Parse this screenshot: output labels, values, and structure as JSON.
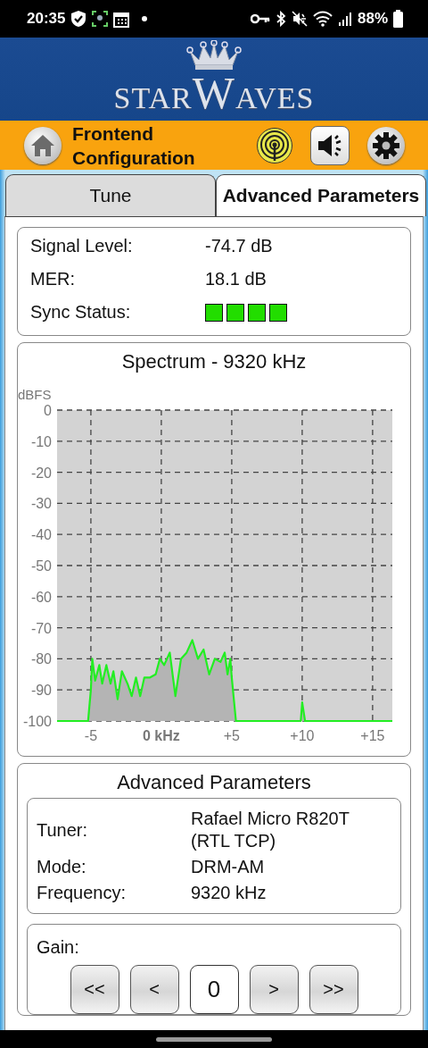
{
  "status_bar": {
    "time": "20:35",
    "battery": "88%"
  },
  "header": {
    "logo": [
      "STAR",
      "W",
      "AVES"
    ]
  },
  "toolbar": {
    "title": "Frontend Configuration"
  },
  "tabs": [
    {
      "label": "Tune",
      "selected": false
    },
    {
      "label": "Advanced Parameters",
      "selected": true
    }
  ],
  "signal": {
    "rows": [
      {
        "label": "Signal Level:",
        "value": "-74.7 dB"
      },
      {
        "label": "MER:",
        "value": "18.1 dB"
      }
    ],
    "sync": {
      "label": "Sync Status:",
      "blocks": [
        {
          "on": true
        },
        {
          "on": true
        },
        {
          "on": true
        },
        {
          "on": true
        }
      ]
    }
  },
  "spectrum": {
    "chart_data": {
      "type": "area",
      "title": "Spectrum - 9320 kHz",
      "ylabel": "dBFS",
      "xlim": [
        -7.4,
        16.4
      ],
      "ylim": [
        -100,
        0
      ],
      "x": [
        -7.4,
        -5.2,
        -5,
        -4.9,
        -4.7,
        -4.4,
        -4.2,
        -3.9,
        -3.6,
        -3.4,
        -3.1,
        -2.8,
        -2.4,
        -2.1,
        -1.8,
        -1.5,
        -1.2,
        -0.8,
        -0.4,
        -0.1,
        0.2,
        0.6,
        1,
        1.4,
        1.8,
        2.2,
        2.6,
        3,
        3.4,
        3.8,
        4.2,
        4.5,
        4.7,
        4.9,
        5,
        5.3,
        9.9,
        10,
        10.2,
        16.4
      ],
      "grid": true,
      "series": [
        {
          "color": "#22ee22",
          "values": [
            -100,
            -100,
            -90,
            -80,
            -87,
            -82,
            -88,
            -82,
            -88,
            -84,
            -93,
            -84,
            -88,
            -92,
            -86,
            -92,
            -86,
            -86,
            -85,
            -80,
            -82,
            -78,
            -92,
            -80,
            -78,
            -74,
            -80,
            -77,
            -85,
            -80,
            -81,
            -78,
            -85,
            -80,
            -86,
            -100,
            -100,
            -94,
            -100,
            -100
          ]
        }
      ],
      "xticks": [
        {
          "value": -5,
          "label": "-5"
        },
        {
          "value": 0,
          "label": "0 kHz"
        },
        {
          "value": 5,
          "label": "+5"
        },
        {
          "value": 10,
          "label": "+10"
        },
        {
          "value": 15,
          "label": "+15"
        }
      ],
      "yticks": [
        0,
        -10,
        -20,
        -30,
        -40,
        -50,
        -60,
        -70,
        -80,
        -90,
        -100
      ]
    }
  },
  "advanced": {
    "title": "Advanced Parameters",
    "rows": [
      {
        "label": "Tuner:",
        "value": "Rafael Micro R820T (RTL TCP)"
      },
      {
        "label": "Mode:",
        "value": "DRM-AM"
      },
      {
        "label": "Frequency:",
        "value": "9320 kHz"
      }
    ],
    "gain": {
      "label": "Gain:",
      "controls": [
        {
          "kind": "button",
          "label": "<<"
        },
        {
          "kind": "button",
          "label": "<"
        },
        {
          "kind": "value",
          "label": "0"
        },
        {
          "kind": "button",
          "label": ">"
        },
        {
          "kind": "button",
          "label": ">>"
        }
      ]
    }
  }
}
